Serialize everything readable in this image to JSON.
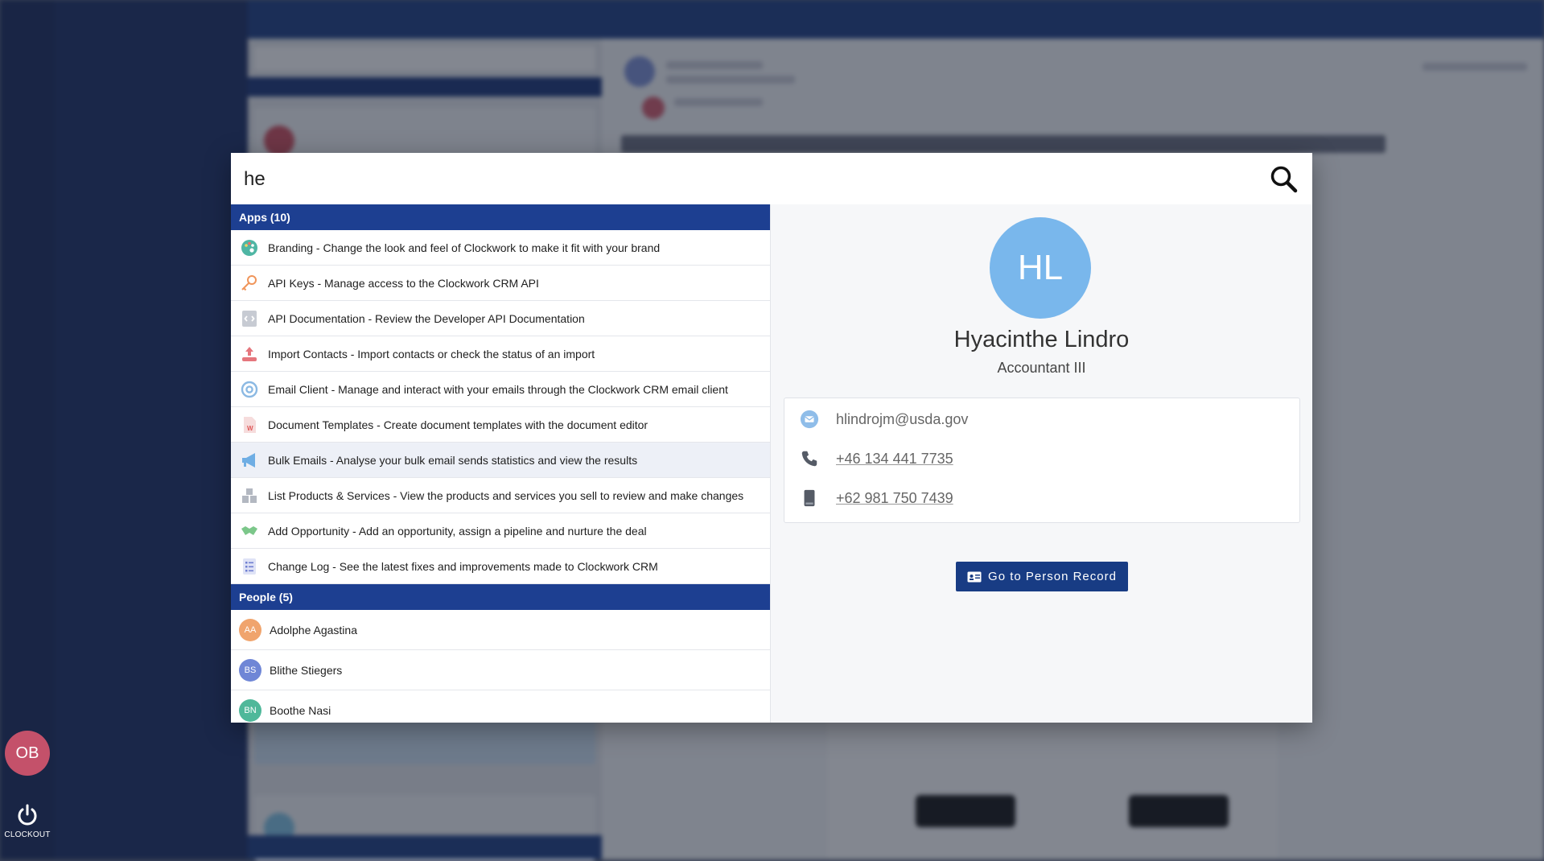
{
  "search": {
    "query": "he"
  },
  "sections": {
    "apps_header": "Apps (10)",
    "people_header": "People (5)"
  },
  "apps": [
    {
      "label": "Branding - Change the look and feel of Clockwork to make it fit with your brand",
      "icon": "palette-icon"
    },
    {
      "label": "API Keys - Manage access to the Clockwork CRM API",
      "icon": "key-icon"
    },
    {
      "label": "API Documentation - Review the Developer API Documentation",
      "icon": "document-icon"
    },
    {
      "label": "Import Contacts - Import contacts or check the status of an import",
      "icon": "upload-icon"
    },
    {
      "label": "Email Client - Manage and interact with your emails through the Clockwork CRM email client",
      "icon": "at-sign-icon"
    },
    {
      "label": "Document Templates - Create document templates with the document editor",
      "icon": "word-document-icon"
    },
    {
      "label": "Bulk Emails - Analyse your bulk email sends statistics and view the results",
      "icon": "megaphone-icon"
    },
    {
      "label": "List Products & Services - View the products and services you sell to review and make changes",
      "icon": "boxes-icon"
    },
    {
      "label": "Add Opportunity - Add an opportunity, assign a pipeline and nurture the deal",
      "icon": "handshake-icon"
    },
    {
      "label": "Change Log - See the latest fixes and improvements made to Clockwork CRM",
      "icon": "checklist-icon"
    }
  ],
  "people": [
    {
      "initials": "AA",
      "name": "Adolphe Agastina",
      "color": "#f0a46d"
    },
    {
      "initials": "BS",
      "name": "Blithe Stiegers",
      "color": "#6f86d6"
    },
    {
      "initials": "BN",
      "name": "Boothe Nasi",
      "color": "#4fb89a"
    }
  ],
  "person": {
    "initials": "HL",
    "name": "Hyacinthe Lindro",
    "title": "Accountant III",
    "email": "hlindrojm@usda.gov",
    "phone": "+46 134 441 7735",
    "mobile": "+62 981 750 7439",
    "button_label": "Go to Person Record",
    "avatar_color": "#79b7ec"
  },
  "sidebar": {
    "user_initials": "OB",
    "clockout_label": "CLOCKOUT"
  },
  "colors": {
    "accent": "#1d3f91",
    "sidebar": "#142659"
  }
}
